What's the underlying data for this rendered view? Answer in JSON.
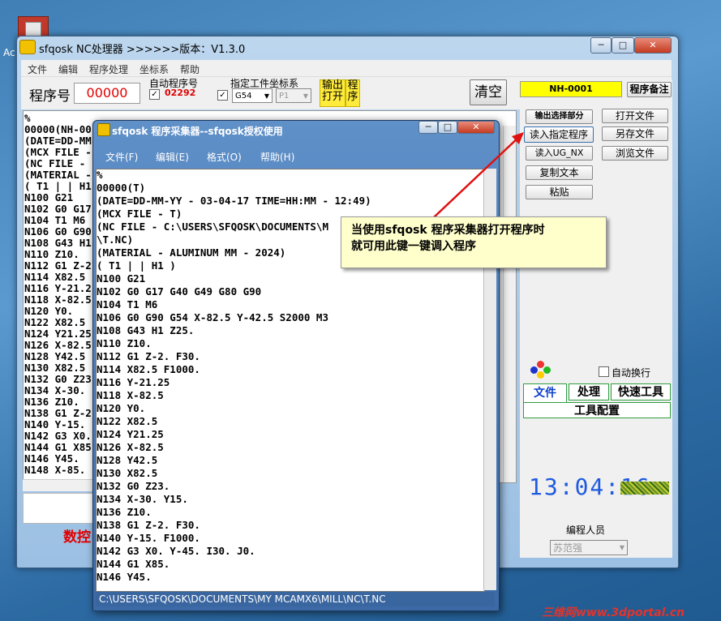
{
  "desktop": {
    "icon_label": "Ac"
  },
  "main_window": {
    "title": "sfqosk NC处理器 >>>>>>版本：V1.3.0",
    "controls": {
      "minimize": "─",
      "maximize": "□",
      "close": "✕"
    },
    "menu": [
      "文件",
      "编辑",
      "程序处理",
      "坐标系",
      "帮助"
    ],
    "toolbar": {
      "program_label": "程序号",
      "program_value": "00000",
      "auto_program_label": "自动程序号",
      "auto_program_value": "02292",
      "auto_program_checked": "✓",
      "coord_label": "指定工件坐标系",
      "coord_checked": "✓",
      "coord_value": "G54",
      "coord_p_value": "P1",
      "output_open_label_1": "输出",
      "output_open_label_2": "打开",
      "program_btn_label_1": "程",
      "program_btn_label_2": "序",
      "clear_label": "清空"
    },
    "left_editor_lines": [
      "%",
      "00000(NH-00",
      "(DATE=DD-MM",
      "(MCX FILE -",
      "(NC FILE -",
      "(MATERIAL -",
      "( T1 | | H1",
      "N100 G21",
      "N102 G0 G17",
      "N104 T1 M6",
      "N106 G0 G90",
      "N108 G43 H1",
      "N110 Z10.",
      "N112 G1 Z-2",
      "N114 X82.5",
      "N116 Y-21.2",
      "N118 X-82.5",
      "N120 Y0.",
      "N122 X82.5",
      "N124 Y21.25",
      "N126 X-82.5",
      "N128 Y42.5",
      "N130 X82.5",
      "N132 G0 Z23",
      "N134 X-30.",
      "N136 Z10.",
      "N138 G1 Z-2",
      "N140 Y-15.",
      "N142 G3 X0.",
      "N144 G1 X85",
      "N146 Y45.",
      "N148 X-85."
    ],
    "red_text": "数控",
    "right_panel": {
      "nh_value": "NH-0001",
      "remark_btn": "程序备注",
      "output_select_btn": "输出选择部分",
      "read_program_btn": "读入指定程序",
      "read_ug_btn": "读入UG_NX",
      "copy_text_btn": "复制文本",
      "paste_btn": "粘贴",
      "open_file_btn": "打开文件",
      "save_as_btn": "另存文件",
      "browse_btn": "浏览文件",
      "auto_wrap_label": "自动换行",
      "tabs": [
        "文件",
        "处理",
        "快速工具"
      ],
      "config_label": "工具配置",
      "clock": "13:04:16",
      "programmer_label": "编程人员",
      "programmer_value": "苏范强"
    }
  },
  "popup_window": {
    "title": "sfqosk 程序采集器--sfqosk授权使用",
    "controls": {
      "minimize": "─",
      "maximize": "□",
      "close": "✕"
    },
    "menu": [
      "文件(F)",
      "编辑(E)",
      "格式(O)",
      "帮助(H)"
    ],
    "lines": [
      "%",
      "00000(T)",
      "(DATE=DD-MM-YY - 03-04-17 TIME=HH:MM - 12:49)",
      "(MCX FILE - T)",
      "(NC FILE - C:\\USERS\\SFQOSK\\DOCUMENTS\\M",
      "\\T.NC)",
      "(MATERIAL - ALUMINUM MM - 2024)",
      "( T1 | | H1 )",
      "N100 G21",
      "N102 G0 G17 G40 G49 G80 G90",
      "N104 T1 M6",
      "N106 G0 G90 G54 X-82.5 Y-42.5 S2000 M3",
      "N108 G43 H1 Z25.",
      "N110 Z10.",
      "N112 G1 Z-2. F30.",
      "N114 X82.5 F1000.",
      "N116 Y-21.25",
      "N118 X-82.5",
      "N120 Y0.",
      "N122 X82.5",
      "N124 Y21.25",
      "N126 X-82.5",
      "N128 Y42.5",
      "N130 X82.5",
      "N132 G0 Z23.",
      "N134 X-30. Y15.",
      "N136 Z10.",
      "N138 G1 Z-2. F30.",
      "N140 Y-15. F1000.",
      "N142 G3 X0. Y-45. I30. J0.",
      "N144 G1 X85.",
      "N146 Y45."
    ],
    "status": "C:\\USERS\\SFQOSK\\DOCUMENTS\\MY MCAMX6\\MILL\\NC\\T.NC"
  },
  "callout": {
    "line1": "当使用sfqosk 程序采集器打开程序时",
    "line2": "就可用此键一键调入程序"
  },
  "watermark": "三维网www.3dportal.cn"
}
